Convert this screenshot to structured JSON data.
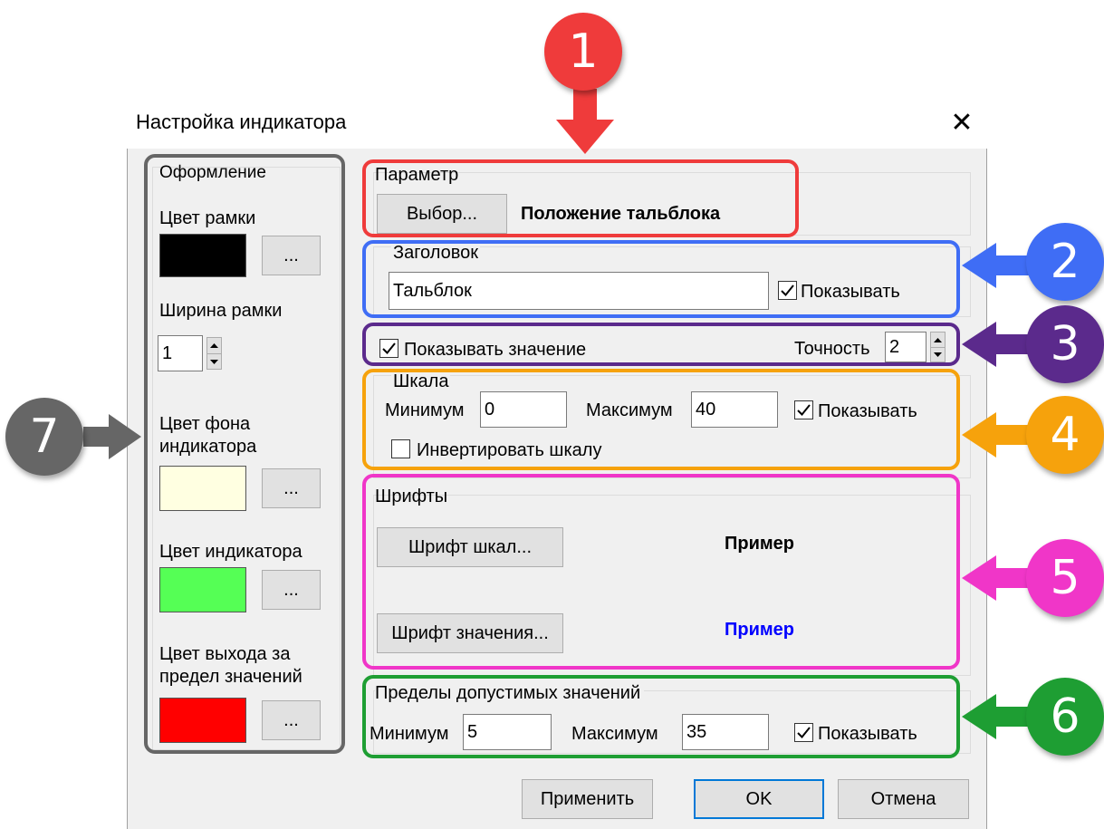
{
  "dialog": {
    "title": "Настройка индикатора",
    "close_glyph": "✕"
  },
  "appearance": {
    "group_label": "Оформление",
    "frame_color_label": "Цвет рамки",
    "frame_color": "#000000",
    "frame_width_label": "Ширина рамки",
    "frame_width_value": "1",
    "bg_color_label": "Цвет фона индикатора",
    "bg_color": "#ffffe1",
    "indicator_color_label": "Цвет индикатора",
    "indicator_color": "#55ff55",
    "out_of_range_color_label": "Цвет выхода за предел значений",
    "out_of_range_color": "#ff0000",
    "browse_label": "..."
  },
  "parameter": {
    "group_label": "Параметр",
    "select_button": "Выбор...",
    "selected_value": "Положение тальблока"
  },
  "header": {
    "group_label": "Заголовок",
    "value": "Тальблок",
    "show_label": "Показывать",
    "show_checked": true
  },
  "value_row": {
    "show_value_label": "Показывать значение",
    "show_value_checked": true,
    "precision_label": "Точность",
    "precision_value": "2"
  },
  "scale": {
    "group_label": "Шкала",
    "min_label": "Минимум",
    "min_value": "0",
    "max_label": "Максимум",
    "max_value": "40",
    "show_label": "Показывать",
    "show_checked": true,
    "invert_label": "Инвертировать шкалу",
    "invert_checked": false
  },
  "fonts": {
    "group_label": "Шрифты",
    "scale_font_button": "Шрифт шкал...",
    "scale_sample": "Пример",
    "scale_sample_color": "#000000",
    "value_font_button": "Шрифт значения...",
    "value_sample": "Пример",
    "value_sample_color": "#0000ff"
  },
  "limits": {
    "group_label": "Пределы допустимых значений",
    "min_label": "Минимум",
    "min_value": "5",
    "max_label": "Максимум",
    "max_value": "35",
    "show_label": "Показывать",
    "show_checked": true
  },
  "footer": {
    "apply_button": "Применить",
    "ok_button": "OK",
    "cancel_button": "Отмена"
  },
  "annotations": {
    "colors": {
      "red": "#ef3b3b",
      "blue": "#3f6df5",
      "purple": "#5b2a8c",
      "orange": "#f6a20c",
      "pink": "#f036c8",
      "green": "#1e9e33",
      "gray": "#666666"
    },
    "markers": [
      {
        "label": "1"
      },
      {
        "label": "2"
      },
      {
        "label": "3"
      },
      {
        "label": "4"
      },
      {
        "label": "5"
      },
      {
        "label": "6"
      },
      {
        "label": "7"
      }
    ]
  }
}
